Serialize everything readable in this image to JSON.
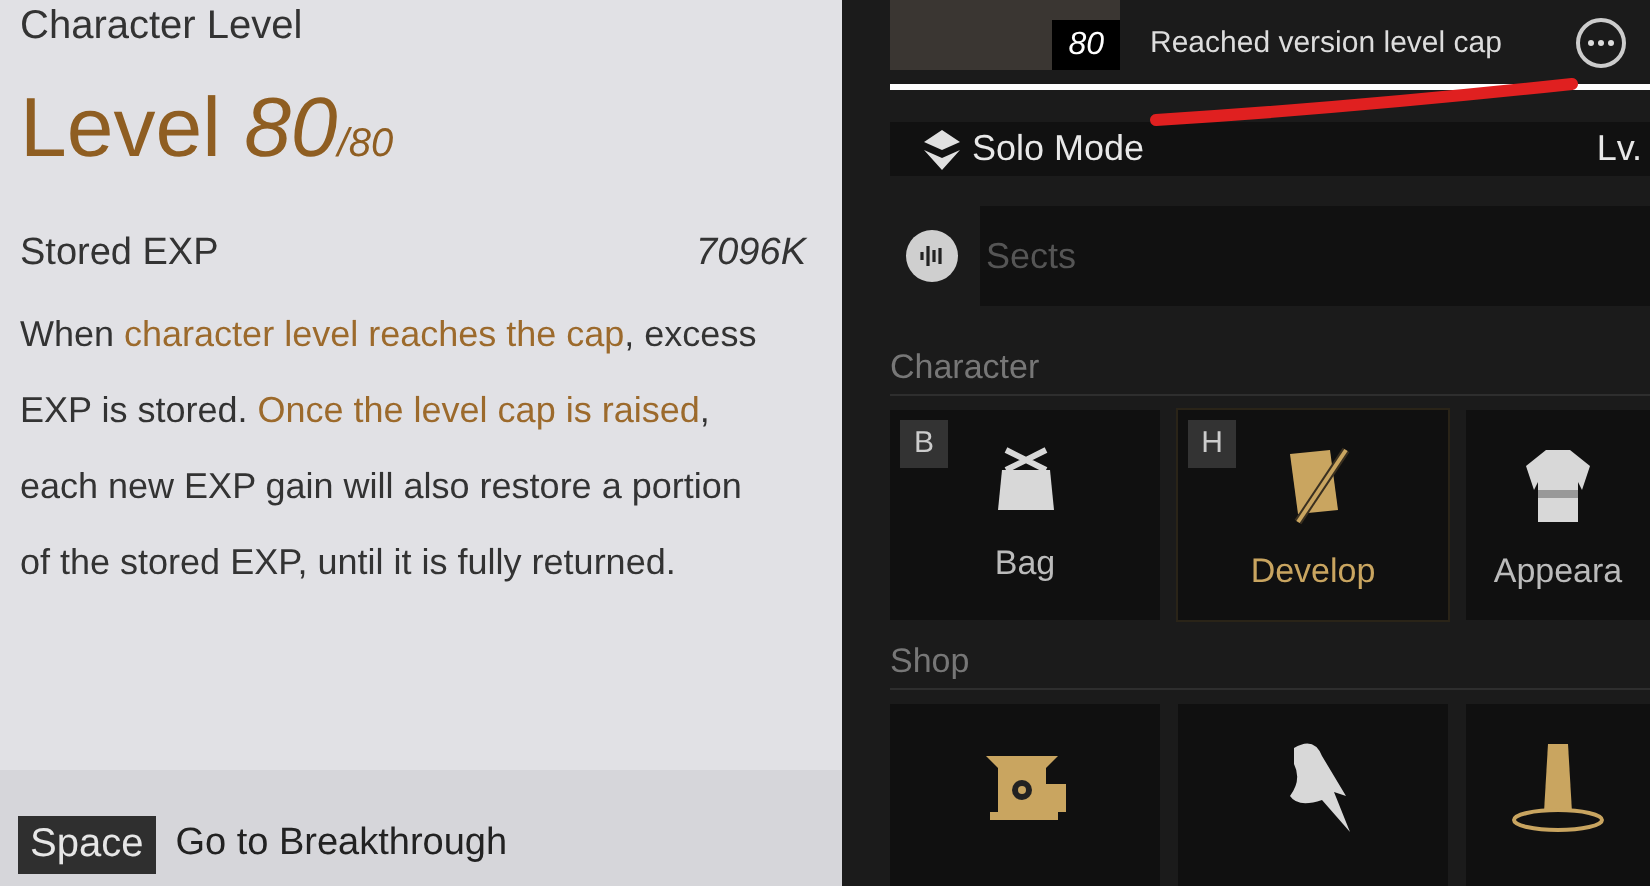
{
  "left_panel": {
    "title": "Character Level",
    "level_label": "Level",
    "level_value": "80",
    "level_max": "/80",
    "stored_exp": {
      "label": "Stored EXP",
      "value": "7096K"
    },
    "description": [
      {
        "text": "When ",
        "highlight": false
      },
      {
        "text": "character level reaches the cap",
        "highlight": true
      },
      {
        "text": ", excess EXP is stored. ",
        "highlight": false
      },
      {
        "text": "Once the level cap is raised",
        "highlight": true
      },
      {
        "text": ", each new EXP gain will also restore a portion of the stored EXP, until it is fully returned.",
        "highlight": false
      }
    ],
    "footer": {
      "key": "Space",
      "label": "Go to Breakthrough"
    }
  },
  "right_panel": {
    "profile": {
      "level_badge": "80",
      "status": "Reached version level cap"
    },
    "mode": {
      "label": "Solo Mode",
      "column_2": "Lv."
    },
    "sects": {
      "placeholder": "Sects"
    },
    "sections": [
      {
        "title": "Character",
        "tiles": [
          {
            "label": "Bag",
            "hotkey": "B",
            "selected": false
          },
          {
            "label": "Develop",
            "hotkey": "H",
            "selected": true
          },
          {
            "label": "Appeara",
            "selected": false
          }
        ]
      },
      {
        "title": "Shop",
        "tiles": [
          {
            "selected": false
          },
          {
            "selected": false
          },
          {
            "selected": false
          }
        ]
      }
    ]
  }
}
